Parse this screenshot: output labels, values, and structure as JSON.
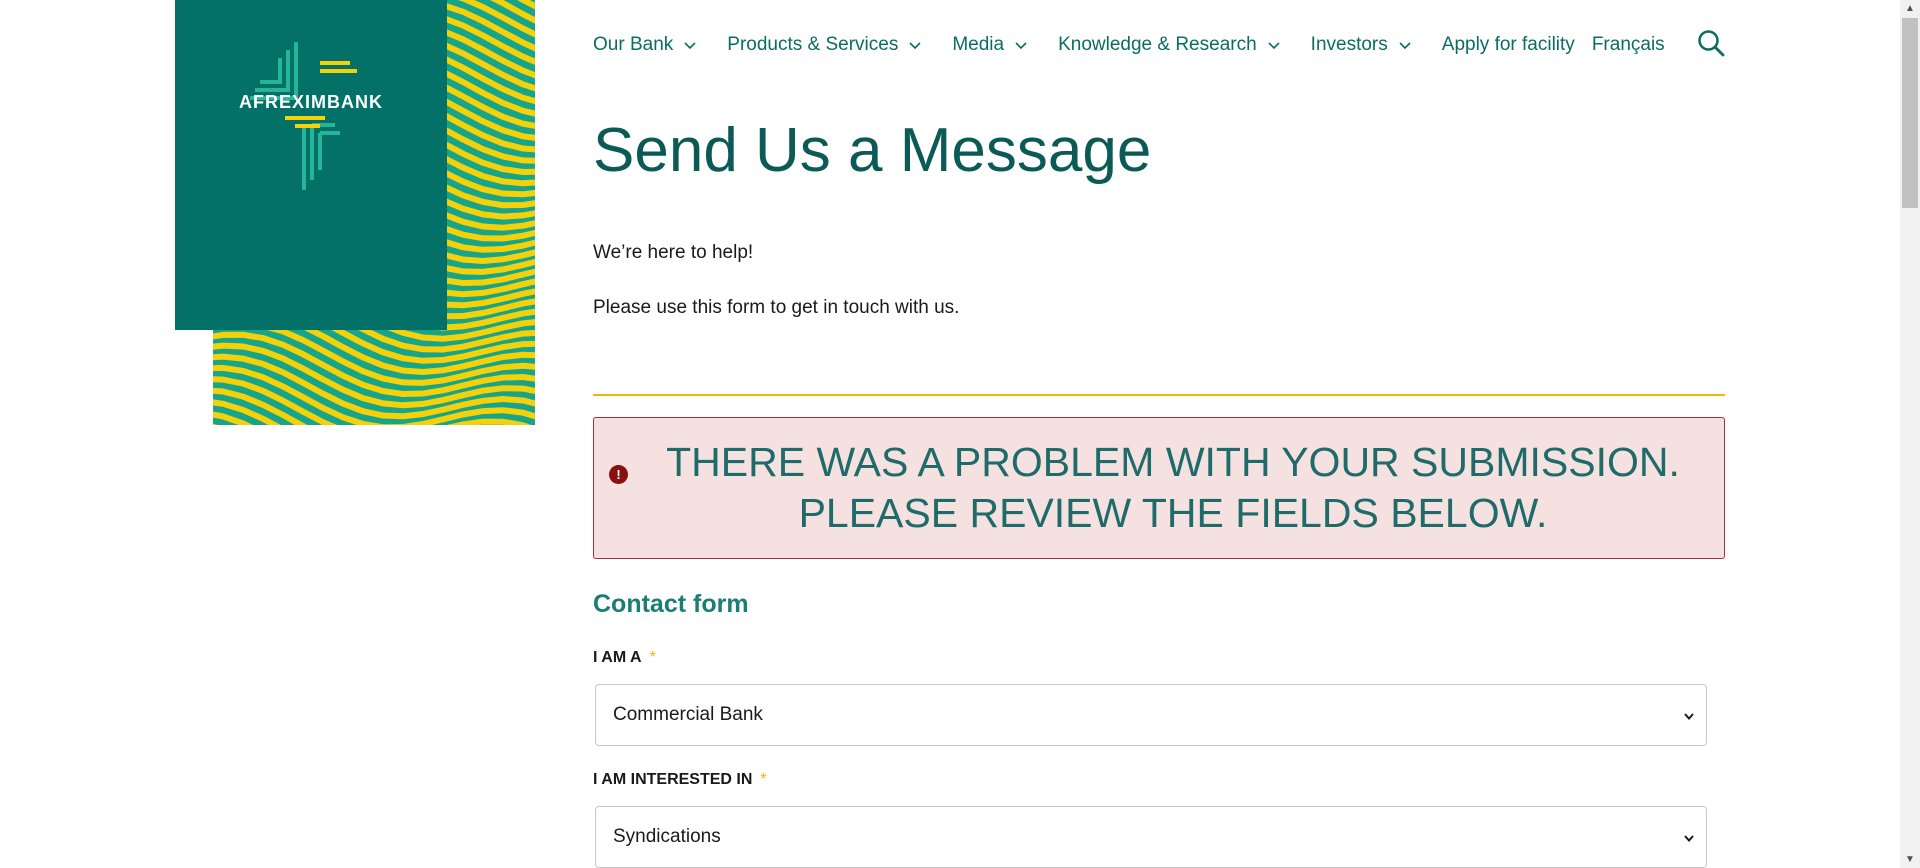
{
  "brand": {
    "logo_text": "AFREXIMBANK",
    "primary_color": "#037168",
    "accent_color": "#f2b705"
  },
  "nav": {
    "items": [
      {
        "label": "Our Bank",
        "has_dropdown": true
      },
      {
        "label": "Products & Services",
        "has_dropdown": true
      },
      {
        "label": "Media",
        "has_dropdown": true
      },
      {
        "label": "Knowledge & Research",
        "has_dropdown": true
      },
      {
        "label": "Investors",
        "has_dropdown": true
      },
      {
        "label": "Apply for facility",
        "has_dropdown": false
      },
      {
        "label": "Français",
        "has_dropdown": false
      }
    ],
    "search_icon": "search-icon"
  },
  "page": {
    "title": "Send Us a Message",
    "intro_line1": "We’re here to help!",
    "intro_line2": "Please use this form to get in touch with us."
  },
  "alert": {
    "icon": "error-icon",
    "message": "THERE WAS A PROBLEM WITH YOUR SUBMISSION. PLEASE REVIEW THE FIELDS BELOW."
  },
  "form": {
    "heading": "Contact form",
    "fields": [
      {
        "label": "I AM A",
        "required_mark": "*",
        "value": "Commercial Bank"
      },
      {
        "label": "I AM INTERESTED IN",
        "required_mark": "*",
        "value": "Syndications"
      }
    ]
  }
}
